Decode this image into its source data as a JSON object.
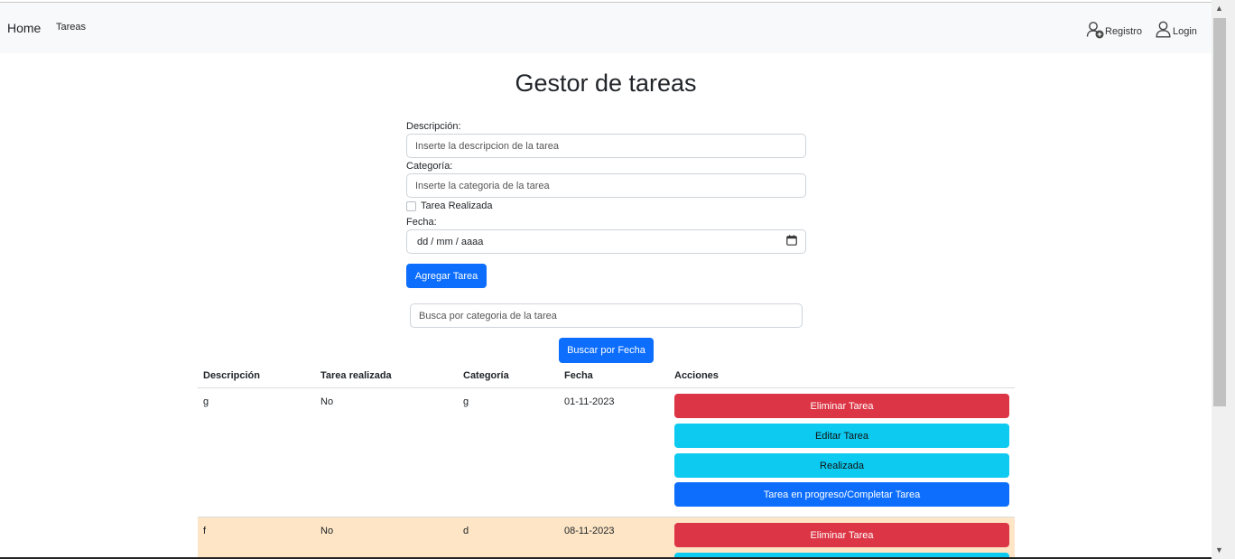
{
  "navbar": {
    "brand": "Home",
    "tareas": "Tareas",
    "registro": "Registro",
    "login": "Login"
  },
  "page": {
    "title": "Gestor de tareas"
  },
  "form": {
    "descripcion_label": "Descripción:",
    "descripcion_placeholder": "Inserte la descripcion de la tarea",
    "categoria_label": "Categoría:",
    "categoria_placeholder": "Inserte la categoria de la tarea",
    "realizada_label": "Tarea Realizada",
    "fecha_label": "Fecha:",
    "fecha_placeholder": "dd / mm / aaaa",
    "submit": "Agregar Tarea"
  },
  "search": {
    "placeholder": "Busca por categoria de la tarea",
    "by_date": "Buscar por Fecha"
  },
  "table": {
    "headers": [
      "Descripción",
      "Tarea realizada",
      "Categoría",
      "Fecha",
      "Acciones"
    ],
    "rows": [
      {
        "descripcion": "g",
        "realizada": "No",
        "categoria": "g",
        "fecha": "01-11-2023"
      },
      {
        "descripcion": "f",
        "realizada": "No",
        "categoria": "d",
        "fecha": "08-11-2023"
      }
    ],
    "actions": {
      "eliminar": "Eliminar Tarea",
      "editar": "Editar Tarea",
      "realizada": "Realizada",
      "progreso": "Tarea en progreso/Completar Tarea"
    }
  },
  "colors": {
    "primary": "#0d6efd",
    "danger": "#dc3545",
    "info": "#0dcaf0",
    "highlight_row": "#fde5c5"
  }
}
